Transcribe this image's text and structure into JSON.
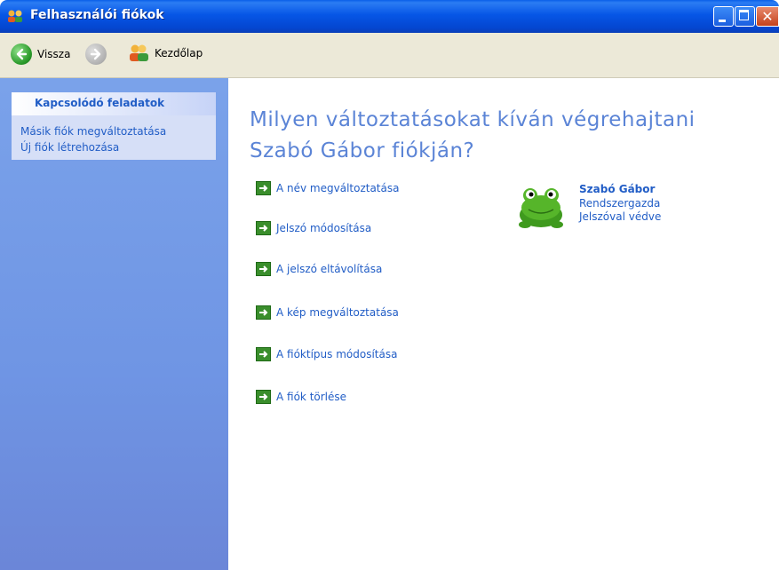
{
  "window": {
    "title": "Felhasználói fiókok"
  },
  "toolbar": {
    "back_label": "Vissza",
    "home_label": "Kezdőlap"
  },
  "sidebar": {
    "panel_title": "Kapcsolódó feladatok",
    "links": [
      "Másik fiók megváltoztatása",
      "Új fiók létrehozása"
    ]
  },
  "main": {
    "heading_line1": "Milyen változtatásokat kíván végrehajtani",
    "heading_line2": "Szabó Gábor fiókján?",
    "actions": [
      "A név megváltoztatása",
      "Jelszó módosítása",
      "A jelszó eltávolítása",
      "A kép megváltoztatása",
      "A fióktípus módosítása",
      "A fiók törlése"
    ],
    "user": {
      "name": "Szabó Gábor",
      "role": "Rendszergazda",
      "status": "Jelszóval védve",
      "picture": "frog-icon"
    }
  },
  "colors": {
    "link": "#215dc6",
    "heading": "#5b84d6",
    "titlebar": "#0656e6",
    "action_arrow": "#3a8e2c"
  }
}
